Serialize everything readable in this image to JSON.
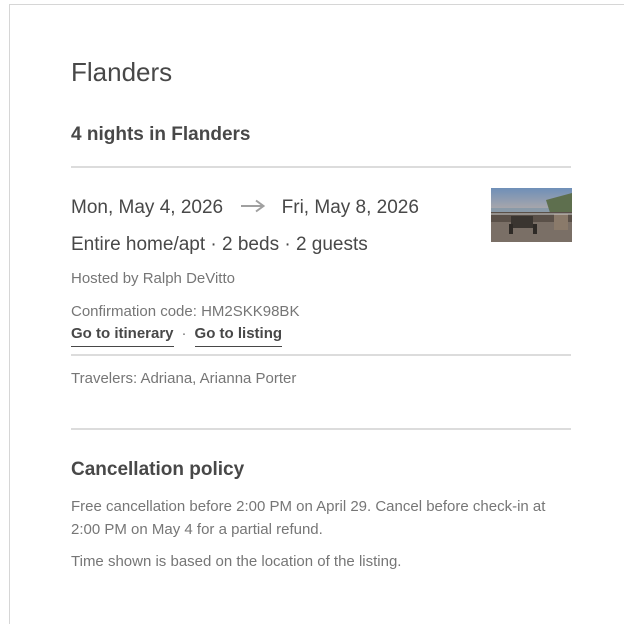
{
  "reservation": {
    "title": "Flanders",
    "subtitle": "4 nights in Flanders",
    "check_in": "Mon, May 4, 2026",
    "check_out": "Fri, May 8, 2026",
    "listing_summary": "Entire home/apt · 2 beds · 2 guests",
    "host": "Hosted by Ralph DeVitto",
    "confirmation": "Confirmation code: HM2SKK98BK",
    "links": {
      "itinerary": "Go to itinerary",
      "separator": "·",
      "listing": "Go to listing"
    },
    "travelers": "Travelers: Adriana, Arianna Porter"
  },
  "cancellation": {
    "heading": "Cancellation policy",
    "policy": "Free cancellation before 2:00 PM on April 29. Cancel before check-in at 2:00 PM on May 4 for a partial refund.",
    "note": "Time shown is based on the location of the listing."
  },
  "colors": {
    "text_dark": "#484848",
    "text_muted": "#767676",
    "divider": "#dcdcdc",
    "border": "#d6d6d6"
  },
  "icons": {
    "date_arrow": "right-arrow-icon",
    "thumbnail": "listing-photo"
  }
}
